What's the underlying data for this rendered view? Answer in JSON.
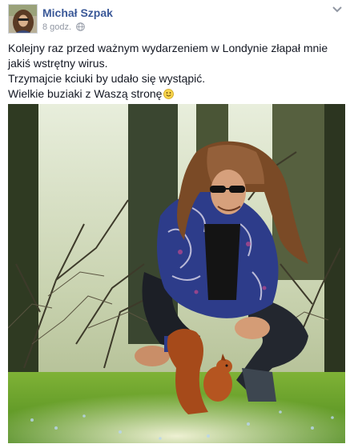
{
  "post": {
    "author": "Michał Szpak",
    "timestamp": "8 godz.",
    "privacy_icon": "globe-icon",
    "options_icon": "chevron-down-icon",
    "text_lines": [
      "Kolejny raz przed ważnym wydarzeniem w Londynie złapał mnie jakiś wstrętny wirus.",
      "Trzymajcie kciuki by udało się wystąpić.",
      "Wielkie buziaki z Waszą stronę"
    ],
    "emoji_icon": "smile-emoji-icon"
  },
  "colors": {
    "author_link": "#3b5998",
    "meta_gray": "#9197a3",
    "text": "#141823"
  }
}
